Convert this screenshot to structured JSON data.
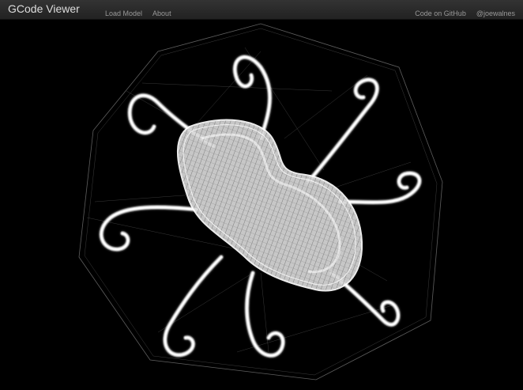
{
  "navbar": {
    "brand": "GCode Viewer",
    "left_links": [
      {
        "label": "Load Model"
      },
      {
        "label": "About"
      }
    ],
    "right_links": [
      {
        "label": "Code on GitHub"
      },
      {
        "label": "@joewalnes"
      }
    ]
  },
  "viewer": {
    "background_color": "#000000",
    "line_color": "#ffffff",
    "tentacle_count": 8
  }
}
